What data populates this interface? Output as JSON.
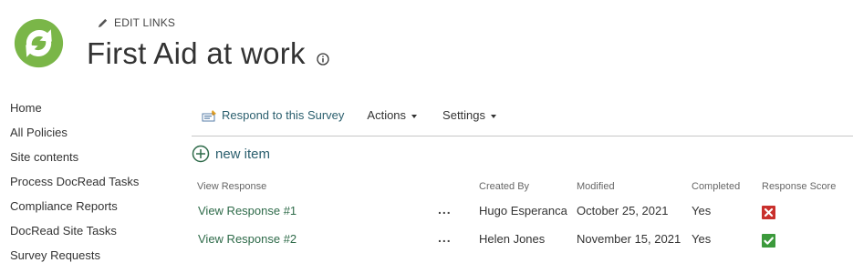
{
  "header": {
    "edit_links_label": "EDIT LINKS",
    "site_title": "First Aid at work",
    "logo_icon": "circular-arrows-logo",
    "info_icon": "info-icon"
  },
  "nav": {
    "items": [
      {
        "label": "Home"
      },
      {
        "label": "All Policies"
      },
      {
        "label": "Site contents"
      },
      {
        "label": "Process DocRead Tasks"
      },
      {
        "label": "Compliance Reports"
      },
      {
        "label": "DocRead Site Tasks"
      },
      {
        "label": "Survey Requests"
      }
    ]
  },
  "toolbar": {
    "respond_label": "Respond to this Survey",
    "actions_label": "Actions",
    "settings_label": "Settings"
  },
  "new_item_label": "new item",
  "table": {
    "columns": [
      "View Response",
      "Created By",
      "Modified",
      "Completed",
      "Response Score"
    ],
    "rows": [
      {
        "view": "View Response #1",
        "menu": "...",
        "created_by": "Hugo Esperanca",
        "modified": "October 25, 2021",
        "completed": "Yes",
        "score": "fail-icon"
      },
      {
        "view": "View Response #2",
        "menu": "...",
        "created_by": "Helen Jones",
        "modified": "November 15, 2021",
        "completed": "Yes",
        "score": "pass-icon"
      }
    ]
  },
  "colors": {
    "link_green": "#2f6b4a",
    "logo_green": "#7ab648",
    "fail_red": "#c9302c",
    "pass_green": "#3c9a3c"
  }
}
